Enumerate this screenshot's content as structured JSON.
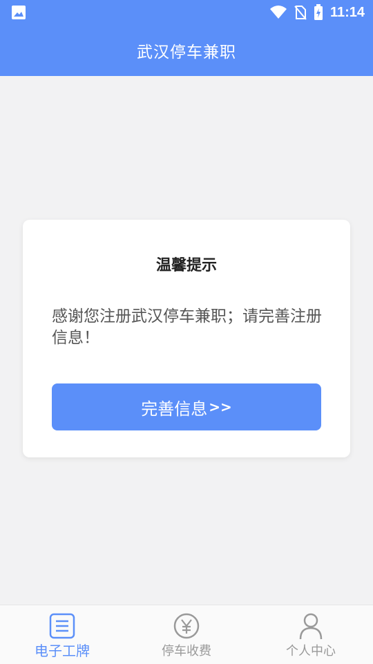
{
  "status_bar": {
    "time": "11:14"
  },
  "app_bar": {
    "title": "武汉停车兼职"
  },
  "dialog": {
    "title": "温馨提示",
    "message": "感谢您注册武汉停车兼职；请完善注册信息！",
    "button_label": "完善信息",
    "button_suffix": ">>"
  },
  "tab_bar": {
    "active_index": 0,
    "tabs": [
      {
        "label": "电子工牌",
        "icon": "badge-icon"
      },
      {
        "label": "停车收费",
        "icon": "yuan-icon"
      },
      {
        "label": "个人中心",
        "icon": "person-icon"
      }
    ]
  },
  "colors": {
    "primary": "#5b8ff9",
    "background": "#f2f2f3",
    "inactive_tab": "#999999"
  }
}
